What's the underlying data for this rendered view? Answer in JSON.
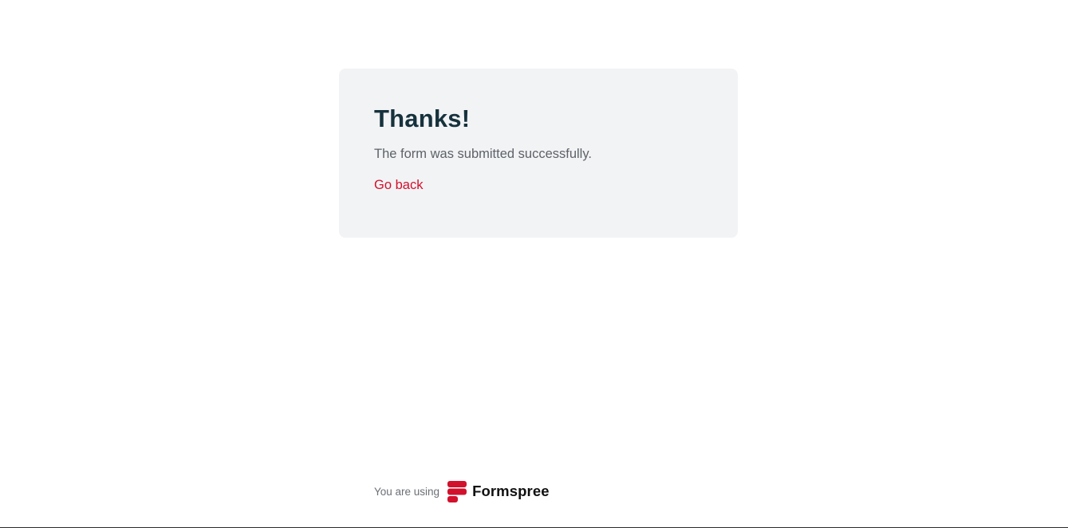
{
  "card": {
    "heading": "Thanks!",
    "message": "The form was submitted successfully.",
    "back_link": "Go back"
  },
  "footer": {
    "prefix": "You are using",
    "brand_name": "Formspree",
    "logo_icon": "formspree-logo-icon"
  },
  "colors": {
    "accent": "#d2112c",
    "heading": "#16323d",
    "card_background": "#f2f3f5"
  }
}
